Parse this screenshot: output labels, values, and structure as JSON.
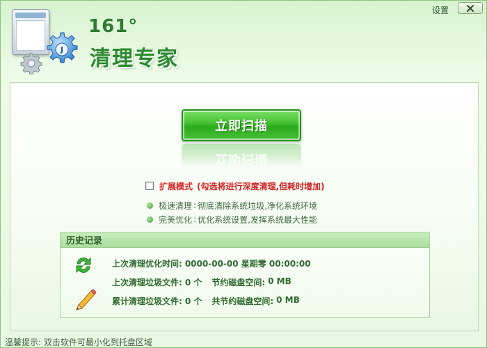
{
  "header": {
    "brand_number": "161°",
    "brand_name": "清理专家",
    "settings_label": "设置"
  },
  "main": {
    "scan_button_label": "立即扫描",
    "extended_mode": {
      "label": "扩展模式",
      "description": "(勾选将进行深度清理,但耗时增加)",
      "checked": false
    },
    "features": [
      {
        "name": "极速清理",
        "desc": "彻底清除系统垃圾,净化系统环境"
      },
      {
        "name": "完美优化",
        "desc": "优化系统设置,发挥系统最大性能"
      }
    ],
    "history": {
      "title": "历史记录",
      "last_time_label": "上次清理优化时间:",
      "last_time_value": "0000-00-00 星期零 00:00:00",
      "last_files_label": "上次清理垃圾文件:",
      "last_files_value": "0 个",
      "last_space_label": "节约磁盘空间:",
      "last_space_value": "0 MB",
      "total_files_label": "累计清理垃圾文件:",
      "total_files_value": "0 个",
      "total_space_label": "共节约磁盘空间:",
      "total_space_value": "0 MB"
    }
  },
  "footer": {
    "tip": "温馨提示: 双击软件可最小化到托盘区域"
  },
  "colors": {
    "accent": "#2b8a2e",
    "warning": "#d32222",
    "panel_bg": "#e8f8e3"
  }
}
